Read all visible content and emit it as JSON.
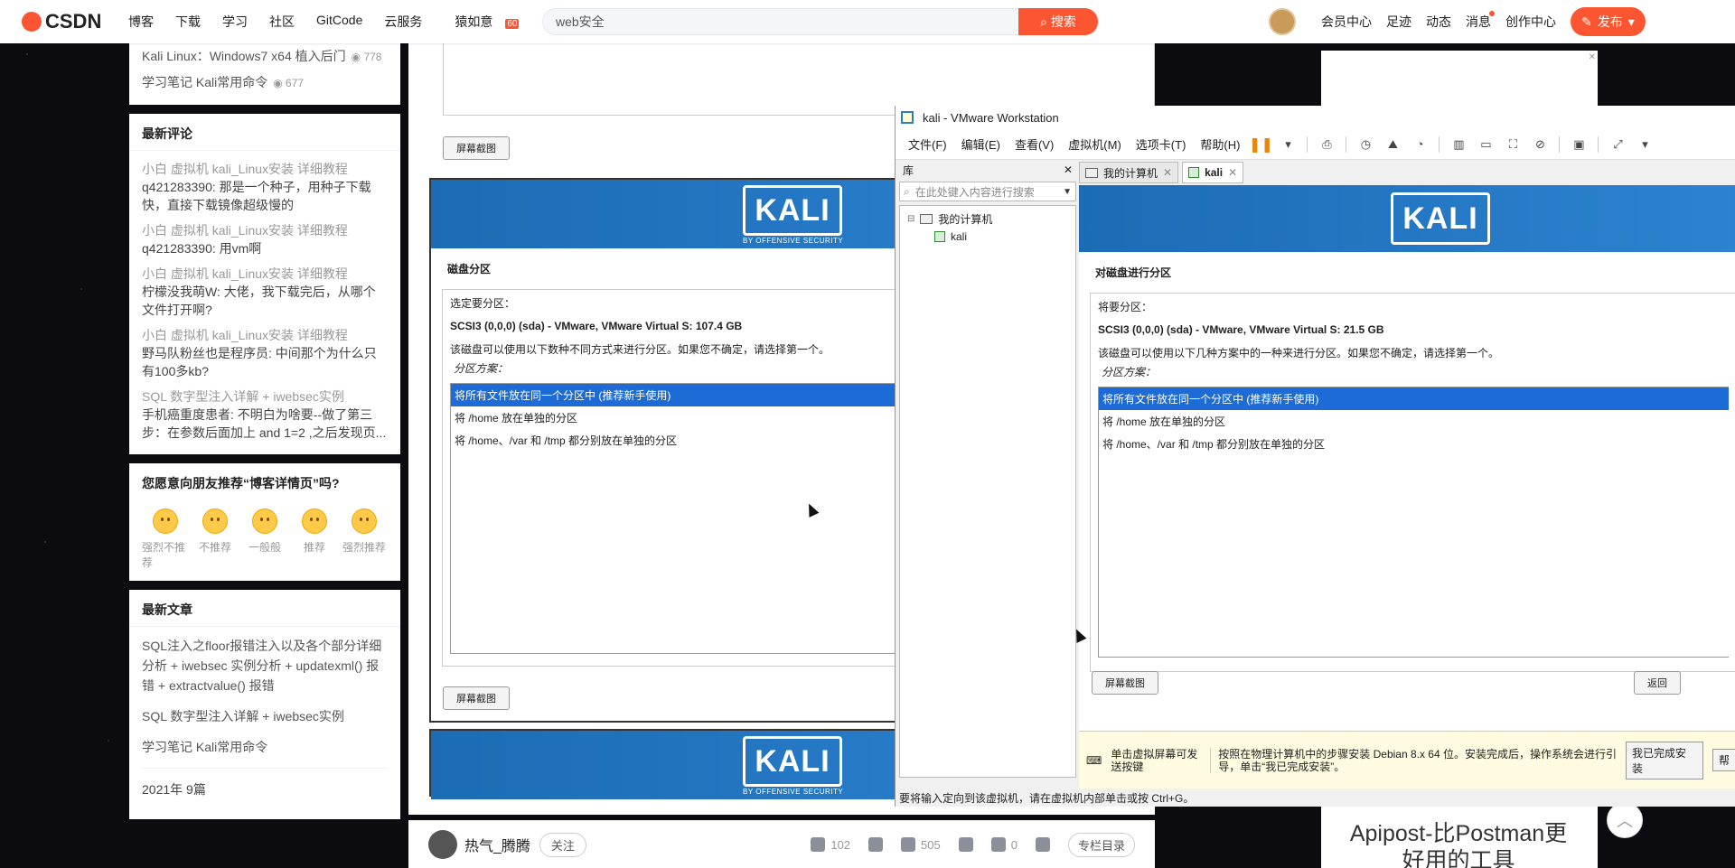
{
  "nav": {
    "logo": "CSDN",
    "items": [
      "博客",
      "下载",
      "学习",
      "社区",
      "GitCode",
      "云服务",
      "猿如意"
    ],
    "badge": "60",
    "search_value": "web安全",
    "search_btn": "搜索",
    "user_links": [
      "会员中心",
      "足迹",
      "动态",
      "消息",
      "创作中心"
    ],
    "publish": "发布"
  },
  "left": {
    "top_items": [
      {
        "text": "Kali Linux：Windows7 x64 植入后门",
        "views": "778"
      },
      {
        "text": "学习笔记 Kali常用命令",
        "views": "677"
      }
    ],
    "comments_title": "最新评论",
    "comments": [
      {
        "title": "小白 虚拟机 kali_Linux安装 详细教程",
        "body": "q421283390: 那是一个种子，用种子下载快，直接下载镜像超级慢的"
      },
      {
        "title": "小白 虚拟机 kali_Linux安装 详细教程",
        "body": "q421283390: 用vm啊"
      },
      {
        "title": "小白 虚拟机 kali_Linux安装 详细教程",
        "body": "柠檬没我萌W: 大佬，我下载完后，从哪个文件打开啊?"
      },
      {
        "title": "小白 虚拟机 kali_Linux安装 详细教程",
        "body": "野马队粉丝也是程序员: 中间那个为什么只有100多kb?"
      },
      {
        "title": "SQL 数字型注入详解 + iwebsec实例",
        "body": "手机癌重度患者: 不明白为啥要--做了第三步：在参数后面加上 and 1=2 ,之后发现页..."
      }
    ],
    "recommend_q": "您愿意向朋友推荐“博客详情页”吗?",
    "emojis": [
      "强烈不推荐",
      "不推荐",
      "一般般",
      "推荐",
      "强烈推荐"
    ],
    "articles_title": "最新文章",
    "articles": [
      "SQL注入之floor报错注入以及各个部分详细分析 + iwebsec 实例分析 + updatexml() 报错 + extractvalue() 报错",
      "SQL 数字型注入详解 + iwebsec实例",
      "学习笔记 Kali常用命令"
    ],
    "archive": "2021年  9篇"
  },
  "center": {
    "screenshot_btn": "屏幕截图",
    "kali_logo": "KALI",
    "kali_sub": "BY OFFENSIVE SECURITY",
    "title": "磁盘分区",
    "label": "选定要分区：",
    "device": "SCSI3 (0,0,0) (sda) - VMware, VMware Virtual S: 107.4 GB",
    "desc": "该磁盘可以使用以下数种不同方式来进行分区。如果您不确定，请选择第一个。",
    "scheme": "分区方案：",
    "options": [
      "将所有文件放在同一个分区中 (推荐新手使用)",
      "将 /home 放在单独的分区",
      "将 /home、/var 和 /tmp 都分别放在单独的分区"
    ]
  },
  "bottom": {
    "author": "热气_腾腾",
    "follow": "关注",
    "likes": "102",
    "favs": "505",
    "comments": "0",
    "column": "专栏目录"
  },
  "ad_text": "Apipost-比Postman更好用的工具",
  "vmware": {
    "title": "kali - VMware Workstation",
    "menu": [
      "文件(F)",
      "编辑(E)",
      "查看(V)",
      "虚拟机(M)",
      "选项卡(T)",
      "帮助(H)"
    ],
    "library": "库",
    "lib_search": "在此处键入内容进行搜索",
    "tree_root": "我的计算机",
    "tree_child": "kali",
    "tabs": [
      "我的计算机",
      "kali"
    ],
    "guest": {
      "kali_logo": "KALI",
      "title": "对磁盘进行分区",
      "label": "将要分区：",
      "device": "SCSI3 (0,0,0) (sda) - VMware, VMware Virtual S: 21.5 GB",
      "desc": "该磁盘可以使用以下几种方案中的一种来进行分区。如果您不确定，请选择第一个。",
      "scheme": "分区方案：",
      "options": [
        "将所有文件放在同一个分区中 (推荐新手使用)",
        "将 /home 放在单独的分区",
        "将 /home、/var 和 /tmp 都分别放在单独的分区"
      ],
      "screenshot_btn": "屏幕截图",
      "back_btn": "返回"
    },
    "hint_left": "单击虚拟屏幕可发送按键",
    "hint_text": "按照在物理计算机中的步骤安装 Debian 8.x 64 位。安装完成后，操作系统会进行引导，单击“我已完成安装”。",
    "hint_btn": "我已完成安装",
    "hint_btn2": "帮",
    "status": "要将输入定向到该虚拟机，请在虚拟机内部单击或按 Ctrl+G。"
  },
  "colors": {
    "brand": "#fc5531",
    "kali_blue": "#1c6bb5",
    "select_blue": "#1c6bd6"
  }
}
